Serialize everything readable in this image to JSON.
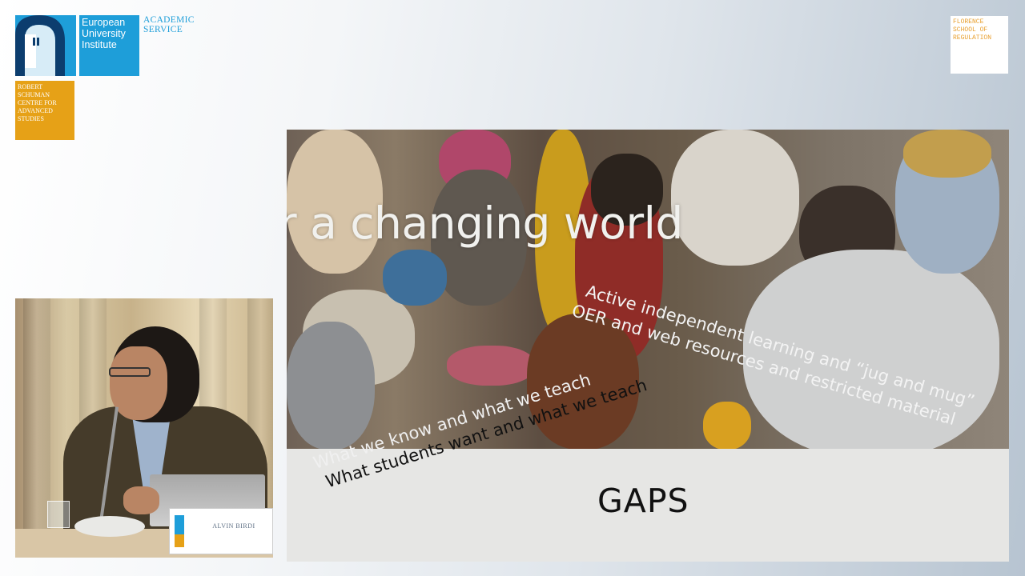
{
  "logos": {
    "eui_name": "European University Institute",
    "academic_service": "ACADEMIC SERVICE",
    "rsc_name": "ROBERT SCHUMAN CENTRE FOR ADVANCED STUDIES",
    "fsr_name": "FLORENCE SCHOOL OF REGULATION",
    "brand_blue": "#1e9ed9",
    "brand_gold": "#e6a117"
  },
  "speaker": {
    "nameplate": "ALVIN BIRDI"
  },
  "slide": {
    "headline": "r a changing world",
    "rotated_right": [
      "Active independent learning and “jug and mug”",
      "OER and web resources and restricted material"
    ],
    "rotated_left": [
      "What we know and what we teach",
      "What students want and what we teach"
    ],
    "title": "GAPS"
  }
}
